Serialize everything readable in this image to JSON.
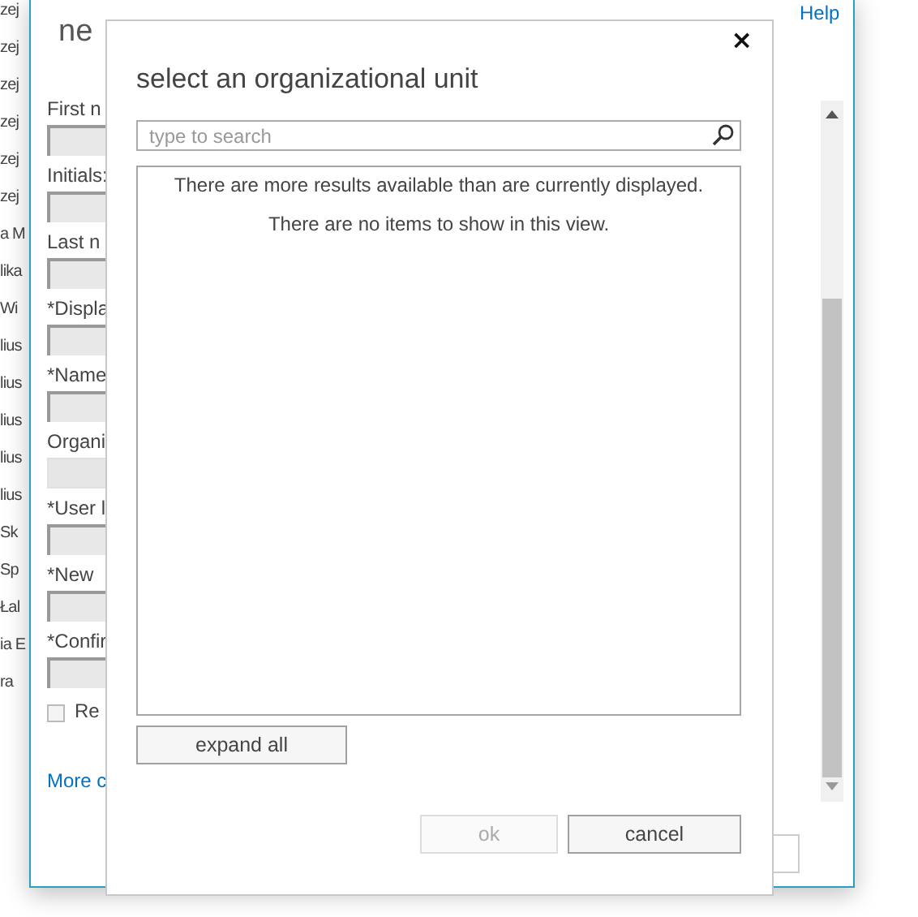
{
  "background_list": {
    "items": [
      "zej",
      "zej",
      "zej",
      "zej",
      "zej",
      "zej",
      "a M",
      "lika",
      "Wi",
      "lius",
      "lius",
      "lius",
      "lius",
      "lius",
      "Sk",
      "Sp",
      "Łal",
      "ia E",
      "ra"
    ]
  },
  "background_window": {
    "title": "ne",
    "help_link": "Help",
    "fields": [
      {
        "label": "First n",
        "disabled": false
      },
      {
        "label": "Initials:",
        "disabled": false
      },
      {
        "label": "Last n",
        "disabled": false
      },
      {
        "label": "*Displa",
        "disabled": false
      },
      {
        "label": "*Name",
        "disabled": false
      },
      {
        "label": "Organi",
        "disabled": true
      },
      {
        "label": "*User l",
        "disabled": false
      },
      {
        "label": "*New",
        "disabled": false
      },
      {
        "label": "*Confir",
        "disabled": false
      }
    ],
    "checkbox": {
      "label": "Re",
      "checked": false
    },
    "more_link": "More c"
  },
  "dialog": {
    "title": "select an organizational unit",
    "close": "×",
    "search": {
      "placeholder": "type to search"
    },
    "messages": [
      "There are more results available than are currently displayed.",
      "There are no items to show in this view."
    ],
    "expand_button": "expand all",
    "buttons": [
      {
        "label": "ok",
        "disabled": true
      },
      {
        "label": "cancel",
        "disabled": false
      }
    ]
  }
}
